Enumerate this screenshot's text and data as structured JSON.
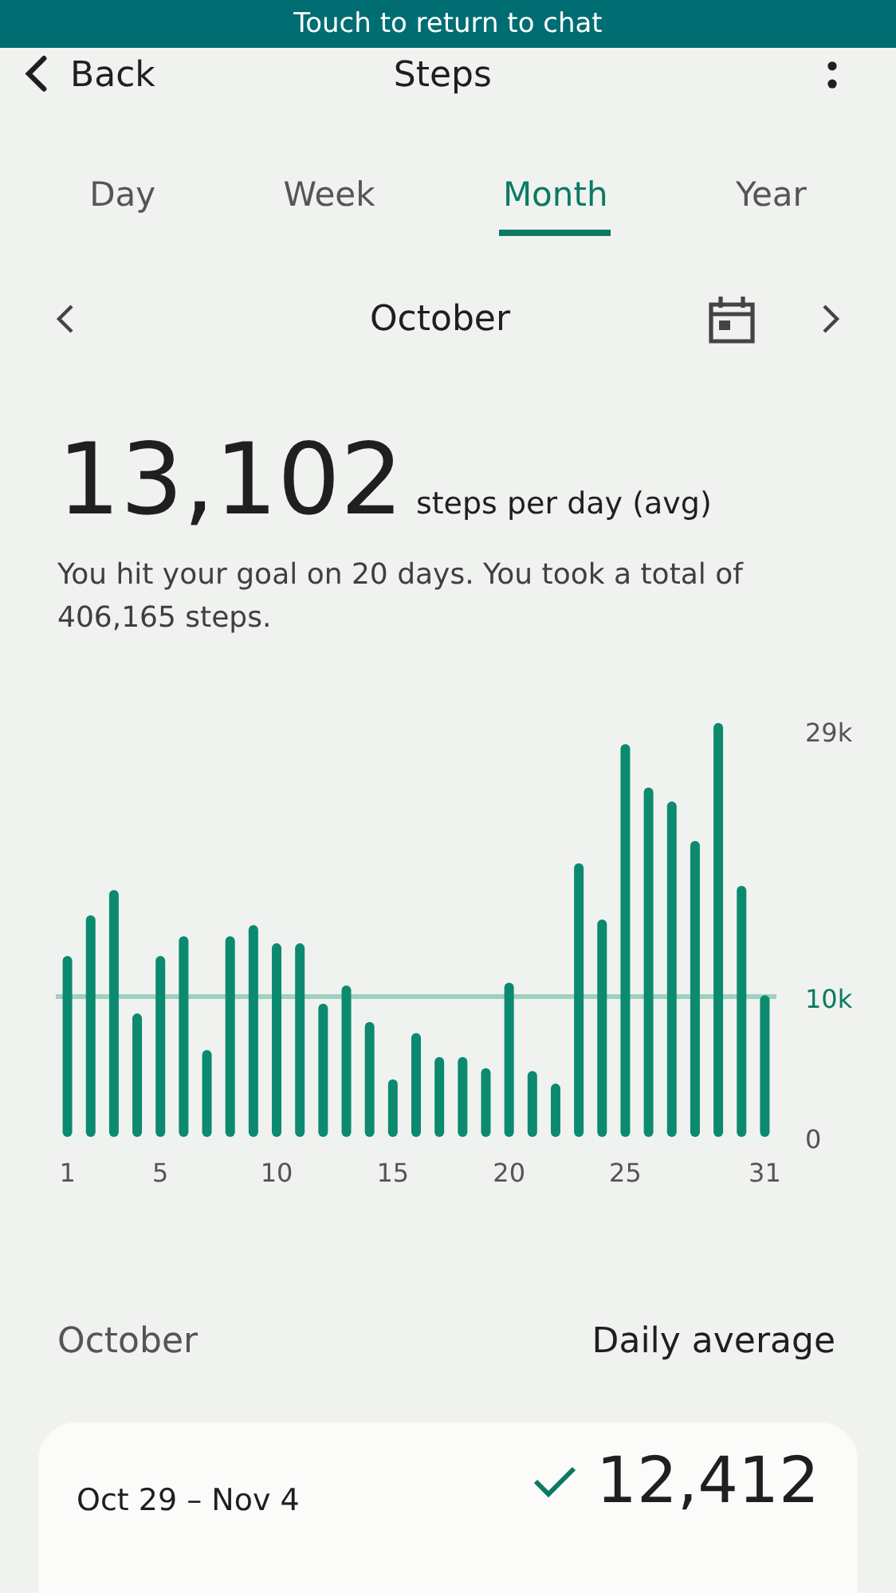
{
  "banner": {
    "text": "Touch to return to chat"
  },
  "header": {
    "back": "Back",
    "title": "Steps"
  },
  "tabs": [
    {
      "label": "Day",
      "selected": false
    },
    {
      "label": "Week",
      "selected": false
    },
    {
      "label": "Month",
      "selected": true
    },
    {
      "label": "Year",
      "selected": false
    }
  ],
  "period": {
    "label": "October"
  },
  "summary": {
    "value": "13,102",
    "unit": "steps per day (avg)",
    "description": "You hit your goal on 20 days. You took a total of 406,165 steps."
  },
  "chart_data": {
    "type": "bar",
    "x": [
      1,
      2,
      3,
      4,
      5,
      6,
      7,
      8,
      9,
      10,
      11,
      12,
      13,
      14,
      15,
      16,
      17,
      18,
      19,
      20,
      21,
      22,
      23,
      24,
      25,
      26,
      27,
      28,
      29,
      30,
      31
    ],
    "series": [
      {
        "color": "#0b8a6f",
        "values": [
          12.9,
          15.8,
          17.6,
          8.8,
          12.9,
          14.3,
          6.2,
          14.3,
          15.1,
          13.8,
          13.8,
          9.5,
          10.8,
          8.2,
          4.1,
          7.4,
          5.7,
          5.7,
          4.9,
          11.0,
          4.7,
          3.8,
          19.5,
          15.5,
          28.0,
          24.9,
          23.9,
          21.1,
          29.5,
          17.9,
          10.1
        ]
      }
    ],
    "xticks": [
      {
        "value": 1,
        "label": "1"
      },
      {
        "value": 5,
        "label": "5"
      },
      {
        "value": 10,
        "label": "10"
      },
      {
        "value": 15,
        "label": "15"
      },
      {
        "value": 20,
        "label": "20"
      },
      {
        "value": 25,
        "label": "25"
      },
      {
        "value": 31,
        "label": "31"
      }
    ],
    "yticks": [
      {
        "value": 0,
        "label": "0"
      },
      {
        "value": 29,
        "label": "29k"
      }
    ],
    "ylim": [
      0,
      30
    ],
    "xlim": [
      0.5,
      31.5
    ],
    "ref_lines": [
      {
        "axis": "y",
        "value": 10,
        "label": "10k"
      }
    ]
  },
  "list": {
    "heading": "October",
    "column": "Daily average",
    "rows": [
      {
        "range": "Oct 29 – Nov 4",
        "value": "12,412",
        "goal_met": true
      }
    ]
  }
}
